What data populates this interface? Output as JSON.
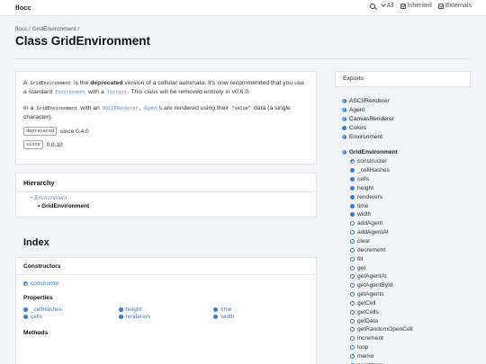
{
  "header": {
    "brand": "flocc",
    "search_label": "",
    "filter_all": "All",
    "filter_inherited": "Inherited",
    "filter_externals": "Externals"
  },
  "breadcrumbs": [
    "flocc",
    "GridEnvironment"
  ],
  "page_title": "Class GridEnvironment",
  "comment": {
    "p1": {
      "a": "A",
      "code1": "GridEnvironment",
      "b": "is the",
      "strong": "deprecated",
      "c": "version of a cellular automata. It's now recommended that you use a standard",
      "code2": "Environment",
      "d": "with a",
      "code3": "Terrain",
      "e": ". This class will be removed entirely in v0.6.0."
    },
    "p2": {
      "a": "In a",
      "code1": "GridEnvironment",
      "b": "with an",
      "code2": "ASCIIRenderer",
      "c": ",",
      "code3": "Agent",
      "d": "s are rendered using their",
      "code4": "\"value\"",
      "e": "data (a single character)."
    },
    "tags": [
      {
        "tag": "deprecated",
        "value": "since 0.4.0"
      },
      {
        "tag": "since",
        "value": "0.0.10"
      }
    ]
  },
  "hierarchy": {
    "title": "Hierarchy",
    "parent": "Environment",
    "current": "GridEnvironment"
  },
  "index": {
    "title": "Index",
    "constructors_title": "Constructors",
    "constructors": [
      "constructor"
    ],
    "properties_title": "Properties",
    "properties": [
      [
        "_cellHashes",
        "cells"
      ],
      [
        "height",
        "renderers"
      ],
      [
        "time",
        "width"
      ]
    ],
    "methods_title": "Methods"
  },
  "sidebar": {
    "exports_label": "Exports",
    "exports": [
      "ASCIIRenderer",
      "Agent",
      "CanvasRenderer",
      "Colors",
      "Environment"
    ],
    "current": "GridEnvironment",
    "members": [
      "constructor",
      "_cellHashes",
      "cells",
      "height",
      "renderers",
      "time",
      "width",
      "addAgent",
      "addAgentAt",
      "clear",
      "decrement",
      "fill",
      "get",
      "getAgentAt",
      "getAgentById",
      "getAgents",
      "getCell",
      "getCells",
      "getData",
      "getRandomOpenCell",
      "increment",
      "loop",
      "memo",
      "neighbors"
    ]
  }
}
